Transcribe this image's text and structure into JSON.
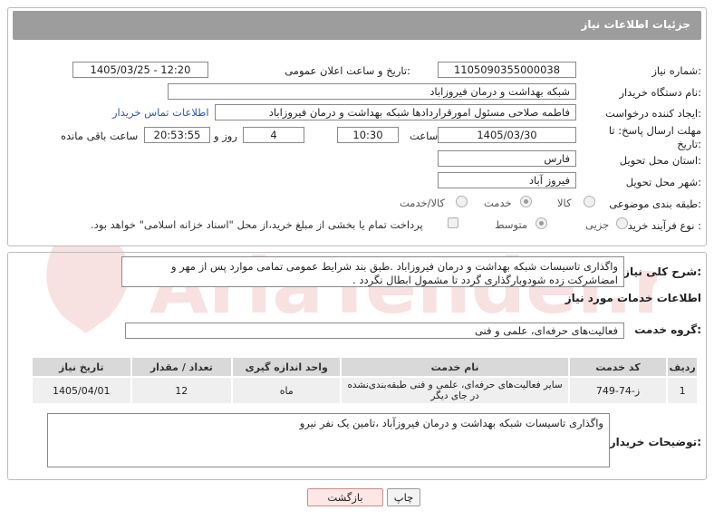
{
  "header": {
    "title": "جزئیات اطلاعات نیاز"
  },
  "fields": {
    "need_number_label": "شماره نیاز:",
    "need_number": "1105090355000038",
    "announce_label": "تاریخ و ساعت اعلان عمومی:",
    "announce_value": "1405/03/25 - 12:20",
    "buyer_org_label": "نام دستگاه خریدار:",
    "buyer_org": "شبکه بهداشت و درمان فیروزاباد",
    "creator_label": "ایجاد کننده درخواست:",
    "creator": "فاطمه صلاحی مسئول امورقراردادها شبکه بهداشت و درمان فیروزاباد",
    "contact_link": "اطلاعات تماس خریدار",
    "deadline_label": "مهلت ارسال پاسخ: تا تاریخ:",
    "deadline_date": "1405/03/30",
    "time_label": "ساعت",
    "deadline_time": "10:30",
    "days_value": "4",
    "days_label": "روز و",
    "remaining_time": "20:53:55",
    "remaining_label": "ساعت باقی مانده",
    "province_label": "استان محل تحویل:",
    "province": "فارس",
    "city_label": "شهر محل تحویل:",
    "city": "فیروز آباد",
    "category_label": "طبقه بندی موضوعی:",
    "category_options": [
      "کالا",
      "خدمت",
      "کالا/خدمت"
    ],
    "purchase_type_label": "نوع فرآیند خرید :",
    "purchase_options": [
      "جزیی",
      "متوسط"
    ],
    "payment_note": "پرداخت تمام یا بخشی از مبلغ خرید،از محل \"اسناد خزانه اسلامی\" خواهد بود."
  },
  "summary": {
    "label": "شرح کلی نیاز:",
    "text": "واگذاری تاسیسات شبکه بهداشت و درمان فیروزاباد   .طبق بند شرایط عمومی تمامی موارد پس از مهر و امضاشرکت  زده شودوبارگذاری گردد تا مشمول ابطال نگردد ."
  },
  "services": {
    "title": "اطلاعات خدمات مورد نیاز",
    "group_label": "گروه خدمت:",
    "group_value": "فعالیت‌های حرفه‌ای، علمی و فنی",
    "columns": [
      "ردیف",
      "کد خدمت",
      "نام خدمت",
      "واحد اندازه گیری",
      "تعداد / مقدار",
      "تاریخ نیاز"
    ],
    "rows": [
      [
        "1",
        "ز-74-749",
        "سایر فعالیت‌های حرفه‌ای، علمی و فنی طبقه‌بندی‌نشده در جای دیگر",
        "ماه",
        "12",
        "1405/04/01"
      ]
    ]
  },
  "buyer_notes": {
    "label": "توضیحات خریدار:",
    "text": "واگذاری تاسیسات شبکه بهداشت و درمان فیروزآباد ،تامین یک نفر  نیرو"
  },
  "buttons": {
    "print": "چاپ",
    "back": "بازگشت"
  }
}
